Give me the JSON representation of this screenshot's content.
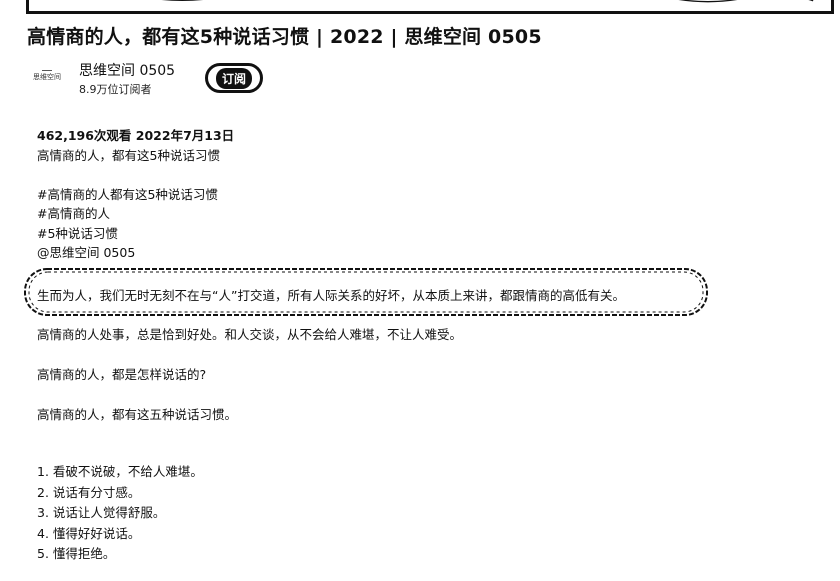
{
  "video": {
    "title": "高情商的人，都有这5种说话习惯 | 2022 | 思维空间 0505"
  },
  "channel": {
    "logo_text": "思维空间",
    "name": "思维空间 0505",
    "subscribers": "8.9万位订阅者",
    "subscribe_label": "订阅"
  },
  "description": {
    "meta": "462,196次观看  2022年7月13日",
    "summary": "高情商的人，都有这5种说话习惯",
    "hashtags": [
      "#高情商的人都有这5种说话习惯",
      "#高情商的人",
      "#5种说话习惯"
    ],
    "mention": " @思维空间 0505",
    "highlight": "生而为人，我们无时无刻不在与“人”打交道，所有人际关系的好坏，从本质上来讲，都跟情商的高低有关。",
    "paragraphs": [
      "高情商的人处事，总是恰到好处。和人交谈，从不会给人难堪，不让人难受。",
      "",
      "高情商的人，都是怎样说话的?",
      "",
      "高情商的人，都有这五种说话习惯。"
    ],
    "list": [
      "1. 看破不说破，不给人难堪。",
      "2. 说话有分寸感。",
      "3. 说话让人觉得舒服。",
      "4. 懂得好好说话。",
      "5. 懂得拒绝。"
    ]
  }
}
